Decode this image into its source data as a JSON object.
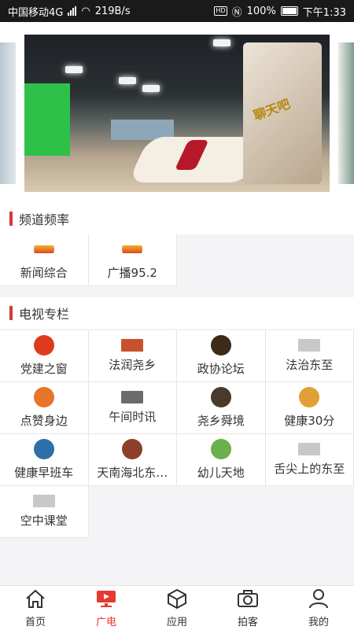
{
  "status_bar": {
    "carrier": "中国移动4G",
    "speed": "219B/s",
    "battery": "100%",
    "time": "下午1:33"
  },
  "banner": {
    "studio_sign": "聊天吧"
  },
  "channels": {
    "title": "频道频率",
    "items": [
      {
        "label": "新闻综合",
        "logo_color": "#d94c1b",
        "icon": "sunset-logo"
      },
      {
        "label": "广播95.2",
        "logo_color": "#d94c1b",
        "icon": "sunset-logo"
      }
    ]
  },
  "tv_columns": {
    "title": "电视专栏",
    "items": [
      {
        "label": "党建之窗",
        "logo_color": "#e03a1e",
        "icon": "party-logo"
      },
      {
        "label": "法润尧乡",
        "logo_color": "#c9502c",
        "icon": "law-logo"
      },
      {
        "label": "政协论坛",
        "logo_color": "#3d2a18",
        "icon": "forum-logo"
      },
      {
        "label": "法治东至",
        "logo_color": "#c8c8c8",
        "icon": "placeholder-logo"
      },
      {
        "label": "点赞身边",
        "logo_color": "#e6742a",
        "icon": "like-logo"
      },
      {
        "label": "午间时讯",
        "logo_color": "#6b6b6b",
        "icon": "news-logo"
      },
      {
        "label": "尧乡舜境",
        "logo_color": "#4a3a2c",
        "icon": "scenery-logo"
      },
      {
        "label": "健康30分",
        "logo_color": "#e1a035",
        "icon": "health-logo"
      },
      {
        "label": "健康早班车",
        "logo_color": "#2f6fa8",
        "icon": "bus-logo"
      },
      {
        "label": "天南海北东…",
        "logo_color": "#8c3f2a",
        "icon": "travel-logo"
      },
      {
        "label": "幼儿天地",
        "logo_color": "#6ab04c",
        "icon": "kids-logo"
      },
      {
        "label": "舌尖上的东至",
        "logo_color": "#c8c8c8",
        "icon": "placeholder-logo"
      },
      {
        "label": "空中课堂",
        "logo_color": "#c8c8c8",
        "icon": "placeholder-logo"
      }
    ]
  },
  "tabbar": {
    "accent": "#e53a2f",
    "items": [
      {
        "label": "首页",
        "icon": "home-icon"
      },
      {
        "label": "广电",
        "icon": "tv-icon"
      },
      {
        "label": "应用",
        "icon": "cube-icon"
      },
      {
        "label": "拍客",
        "icon": "camera-icon"
      },
      {
        "label": "我的",
        "icon": "user-icon"
      }
    ]
  }
}
